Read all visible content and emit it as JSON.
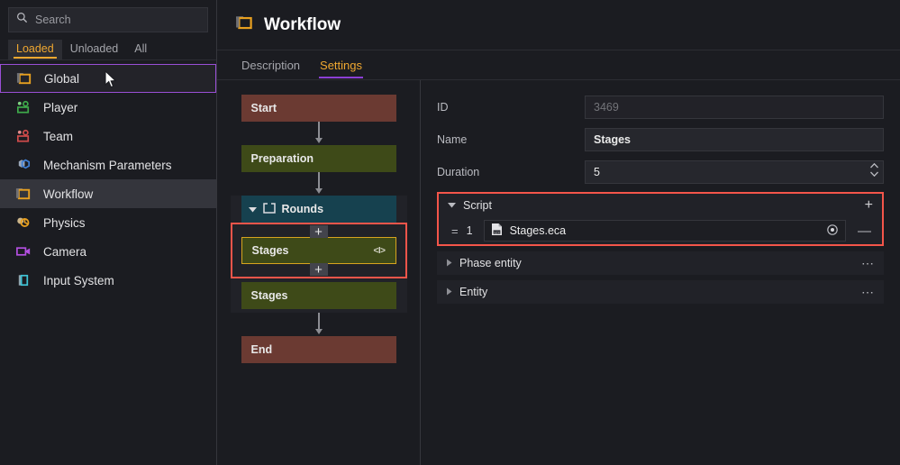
{
  "sidebar": {
    "search": {
      "placeholder": "Search",
      "value": "",
      "icon": "search-icon"
    },
    "tabs": [
      {
        "label": "Loaded",
        "active": true
      },
      {
        "label": "Unloaded",
        "active": false
      },
      {
        "label": "All",
        "active": false
      }
    ],
    "items": [
      {
        "label": "Global",
        "icon": "folder-icon",
        "state": "hovered"
      },
      {
        "label": "Player",
        "icon": "player-icon",
        "state": "normal"
      },
      {
        "label": "Team",
        "icon": "team-icon",
        "state": "normal"
      },
      {
        "label": "Mechanism Parameters",
        "icon": "mechanism-icon",
        "state": "normal"
      },
      {
        "label": "Workflow",
        "icon": "folder-icon",
        "state": "selected"
      },
      {
        "label": "Physics",
        "icon": "physics-icon",
        "state": "normal"
      },
      {
        "label": "Camera",
        "icon": "camera-icon",
        "state": "normal"
      },
      {
        "label": "Input System",
        "icon": "input-system-icon",
        "state": "normal"
      }
    ]
  },
  "header": {
    "title": "Workflow",
    "icon": "folder-icon",
    "tabs": [
      {
        "label": "Description",
        "active": false
      },
      {
        "label": "Settings",
        "active": true
      }
    ]
  },
  "flow": {
    "nodes": [
      {
        "label": "Start",
        "type": "start"
      },
      {
        "label": "Preparation",
        "type": "prep"
      },
      {
        "label": "Rounds",
        "type": "rounds",
        "expanded": true,
        "icon": "node-folder-icon"
      },
      {
        "label": "Stages",
        "type": "stage",
        "selected": true,
        "code_icon": "<I>"
      },
      {
        "label": "Stages",
        "type": "stage",
        "selected": false
      },
      {
        "label": "End",
        "type": "end"
      }
    ],
    "add_button_label": "+"
  },
  "properties": {
    "fields": [
      {
        "label": "ID",
        "value": "3469",
        "disabled": true
      },
      {
        "label": "Name",
        "value": "Stages",
        "disabled": false
      },
      {
        "label": "Duration",
        "value": "5",
        "disabled": false,
        "spinner": true
      }
    ],
    "script_section": {
      "title": "Script",
      "expanded": true,
      "add_label": "+",
      "rows": [
        {
          "handle": "=",
          "index": "1",
          "file_name": "Stages.eca",
          "file_icon": "script-file-icon",
          "picker_icon": "target-picker-icon",
          "remove_label": "—"
        }
      ]
    },
    "collapsed_sections": [
      {
        "title": "Phase entity",
        "menu": "⋯"
      },
      {
        "title": "Entity",
        "menu": "⋯"
      }
    ]
  },
  "colors": {
    "accent_orange": "#f0a830",
    "accent_purple": "#8b3fd4",
    "highlight_red": "#f4554a",
    "node_start": "#6b3a32",
    "node_stage": "#3e4a18",
    "node_rounds": "#16414f",
    "selected_border": "#d7a41e"
  }
}
